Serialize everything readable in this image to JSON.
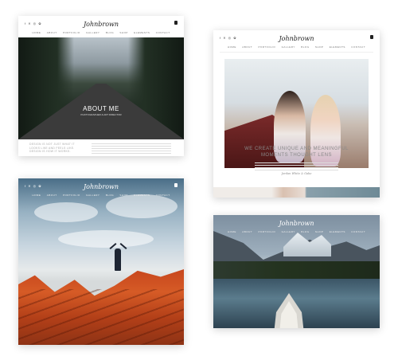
{
  "brand": "Johnbrown",
  "social_icons": "f ✕ ◎ ✿",
  "nav_items": [
    "HOME",
    "ABOUT",
    "PORTFOLIO",
    "GALLERY",
    "BLOG",
    "SHOP",
    "ELEMENTS",
    "CONTACT"
  ],
  "card_about": {
    "title": "ABOUT ME",
    "subtitle": "PHOTOGRAPHER & ART DIRECTOR",
    "heading": "DESIGN IS NOT JUST WHAT IT LOOKS LIKE AND FEELS LIKE. DESIGN IS HOW IT WORKS."
  },
  "card_wedding": {
    "caption_line1": "WE CREATE UNIQUE AND MEANINGFUL",
    "caption_line2": "MOMENTS THOUGHT LENS",
    "signature": "Jordan White & Gabe"
  }
}
